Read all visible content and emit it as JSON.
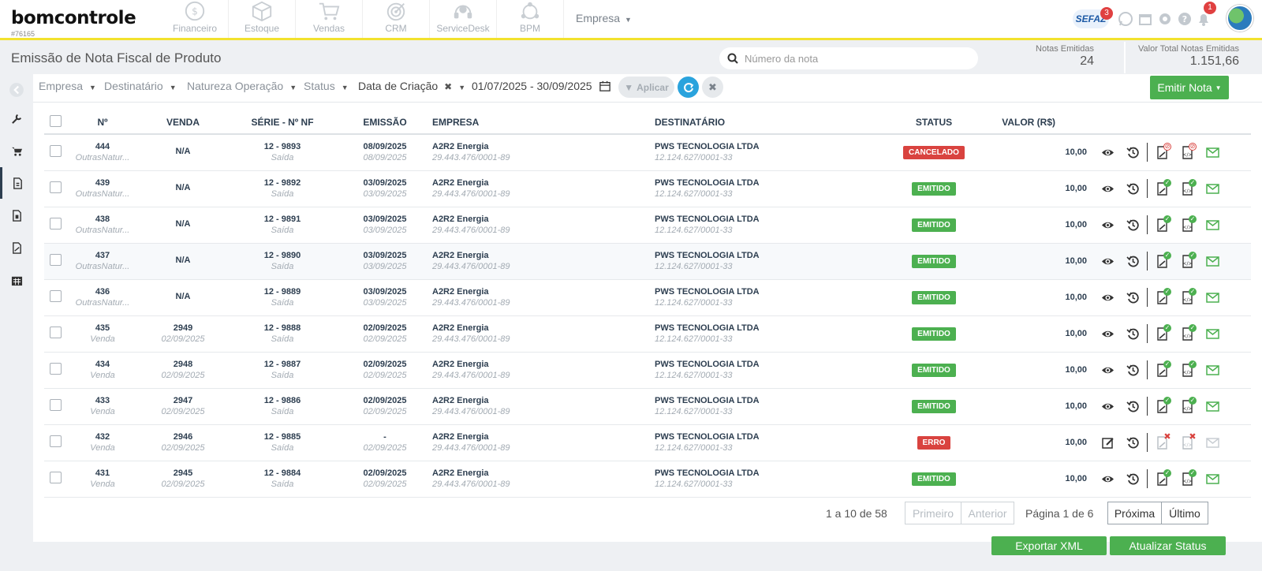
{
  "app": {
    "logo": "bomcontrole",
    "account_code": "#76165"
  },
  "modules": [
    {
      "label": "Financeiro",
      "icon": "coin-icon"
    },
    {
      "label": "Estoque",
      "icon": "box-icon"
    },
    {
      "label": "Vendas",
      "icon": "cart-icon"
    },
    {
      "label": "CRM",
      "icon": "target-icon"
    },
    {
      "label": "ServiceDesk",
      "icon": "headset-icon"
    },
    {
      "label": "BPM",
      "icon": "network-icon"
    }
  ],
  "empresa_menu": "Empresa",
  "top_right": {
    "sefaz": "SEFAZ",
    "sefaz_count": "3",
    "notifications_count": "1"
  },
  "header": {
    "title": "Emissão de Nota Fiscal de Produto",
    "search_placeholder": "Número da nota",
    "notas_emitidas_label": "Notas Emitidas",
    "notas_emitidas_value": "24",
    "valor_total_label": "Valor Total Notas Emitidas",
    "valor_total_value": "1.151,66"
  },
  "filters": {
    "empresa": "Empresa",
    "destinatario": "Destinatário",
    "natureza": "Natureza Operação",
    "status": "Status",
    "data_criacao": "Data de Criação",
    "date_range": "01/07/2025 - 30/09/2025",
    "aplicar": "Aplicar",
    "emitir": "Emitir Nota"
  },
  "table": {
    "columns": [
      "Nº",
      "VENDA",
      "SÉRIE - Nº NF",
      "EMISSÃO",
      "EMPRESA",
      "DESTINATÁRIO",
      "STATUS",
      "VALOR (R$)"
    ],
    "rows": [
      {
        "num": "444",
        "num_sub": "OutrasNatur...",
        "venda": "N/A",
        "venda_sub": "",
        "serie": "12 - 9893",
        "serie_sub": "Saída",
        "emissao": "08/09/2025",
        "emissao_sub": "08/09/2025",
        "empresa": "A2R2 Energia",
        "empresa_cnpj": "29.443.476/0001-89",
        "dest": "PWS TECNOLOGIA LTDA",
        "dest_cnpj": "12.124.627/0001-33",
        "status": "CANCELADO",
        "status_kind": "red",
        "valor": "10,00",
        "mode": "cancel"
      },
      {
        "num": "439",
        "num_sub": "OutrasNatur...",
        "venda": "N/A",
        "venda_sub": "",
        "serie": "12 - 9892",
        "serie_sub": "Saída",
        "emissao": "03/09/2025",
        "emissao_sub": "03/09/2025",
        "empresa": "A2R2 Energia",
        "empresa_cnpj": "29.443.476/0001-89",
        "dest": "PWS TECNOLOGIA LTDA",
        "dest_cnpj": "12.124.627/0001-33",
        "status": "EMITIDO",
        "status_kind": "green",
        "valor": "10,00",
        "mode": "ok"
      },
      {
        "num": "438",
        "num_sub": "OutrasNatur...",
        "venda": "N/A",
        "venda_sub": "",
        "serie": "12 - 9891",
        "serie_sub": "Saída",
        "emissao": "03/09/2025",
        "emissao_sub": "03/09/2025",
        "empresa": "A2R2 Energia",
        "empresa_cnpj": "29.443.476/0001-89",
        "dest": "PWS TECNOLOGIA LTDA",
        "dest_cnpj": "12.124.627/0001-33",
        "status": "EMITIDO",
        "status_kind": "green",
        "valor": "10,00",
        "mode": "ok"
      },
      {
        "num": "437",
        "num_sub": "OutrasNatur...",
        "venda": "N/A",
        "venda_sub": "",
        "serie": "12 - 9890",
        "serie_sub": "Saída",
        "emissao": "03/09/2025",
        "emissao_sub": "03/09/2025",
        "empresa": "A2R2 Energia",
        "empresa_cnpj": "29.443.476/0001-89",
        "dest": "PWS TECNOLOGIA LTDA",
        "dest_cnpj": "12.124.627/0001-33",
        "status": "EMITIDO",
        "status_kind": "green",
        "valor": "10,00",
        "mode": "ok"
      },
      {
        "num": "436",
        "num_sub": "OutrasNatur...",
        "venda": "N/A",
        "venda_sub": "",
        "serie": "12 - 9889",
        "serie_sub": "Saída",
        "emissao": "03/09/2025",
        "emissao_sub": "03/09/2025",
        "empresa": "A2R2 Energia",
        "empresa_cnpj": "29.443.476/0001-89",
        "dest": "PWS TECNOLOGIA LTDA",
        "dest_cnpj": "12.124.627/0001-33",
        "status": "EMITIDO",
        "status_kind": "green",
        "valor": "10,00",
        "mode": "ok"
      },
      {
        "num": "435",
        "num_sub": "Venda",
        "venda": "2949",
        "venda_sub": "02/09/2025",
        "serie": "12 - 9888",
        "serie_sub": "Saída",
        "emissao": "02/09/2025",
        "emissao_sub": "02/09/2025",
        "empresa": "A2R2 Energia",
        "empresa_cnpj": "29.443.476/0001-89",
        "dest": "PWS TECNOLOGIA LTDA",
        "dest_cnpj": "12.124.627/0001-33",
        "status": "EMITIDO",
        "status_kind": "green",
        "valor": "10,00",
        "mode": "ok"
      },
      {
        "num": "434",
        "num_sub": "Venda",
        "venda": "2948",
        "venda_sub": "02/09/2025",
        "serie": "12 - 9887",
        "serie_sub": "Saída",
        "emissao": "02/09/2025",
        "emissao_sub": "02/09/2025",
        "empresa": "A2R2 Energia",
        "empresa_cnpj": "29.443.476/0001-89",
        "dest": "PWS TECNOLOGIA LTDA",
        "dest_cnpj": "12.124.627/0001-33",
        "status": "EMITIDO",
        "status_kind": "green",
        "valor": "10,00",
        "mode": "ok"
      },
      {
        "num": "433",
        "num_sub": "Venda",
        "venda": "2947",
        "venda_sub": "02/09/2025",
        "serie": "12 - 9886",
        "serie_sub": "Saída",
        "emissao": "02/09/2025",
        "emissao_sub": "02/09/2025",
        "empresa": "A2R2 Energia",
        "empresa_cnpj": "29.443.476/0001-89",
        "dest": "PWS TECNOLOGIA LTDA",
        "dest_cnpj": "12.124.627/0001-33",
        "status": "EMITIDO",
        "status_kind": "green",
        "valor": "10,00",
        "mode": "ok"
      },
      {
        "num": "432",
        "num_sub": "Venda",
        "venda": "2946",
        "venda_sub": "02/09/2025",
        "serie": "12 - 9885",
        "serie_sub": "Saída",
        "emissao": "-",
        "emissao_sub": "02/09/2025",
        "empresa": "A2R2 Energia",
        "empresa_cnpj": "29.443.476/0001-89",
        "dest": "PWS TECNOLOGIA LTDA",
        "dest_cnpj": "12.124.627/0001-33",
        "status": "ERRO",
        "status_kind": "red",
        "valor": "10,00",
        "mode": "error"
      },
      {
        "num": "431",
        "num_sub": "Venda",
        "venda": "2945",
        "venda_sub": "02/09/2025",
        "serie": "12 - 9884",
        "serie_sub": "Saída",
        "emissao": "02/09/2025",
        "emissao_sub": "02/09/2025",
        "empresa": "A2R2 Energia",
        "empresa_cnpj": "29.443.476/0001-89",
        "dest": "PWS TECNOLOGIA LTDA",
        "dest_cnpj": "12.124.627/0001-33",
        "status": "EMITIDO",
        "status_kind": "green",
        "valor": "10,00",
        "mode": "ok"
      }
    ]
  },
  "pagination": {
    "range": "1 a 10 de 58",
    "primeiro": "Primeiro",
    "anterior": "Anterior",
    "pagina": "Página 1 de 6",
    "proxima": "Próxima",
    "ultimo": "Último"
  },
  "footer": {
    "exportar": "Exportar XML",
    "atualizar": "Atualizar Status"
  },
  "colors": {
    "accent_green": "#4cb050",
    "status_red": "#d9433f",
    "header_underline": "#f2e22e",
    "refresh_blue": "#2aa3dd"
  }
}
